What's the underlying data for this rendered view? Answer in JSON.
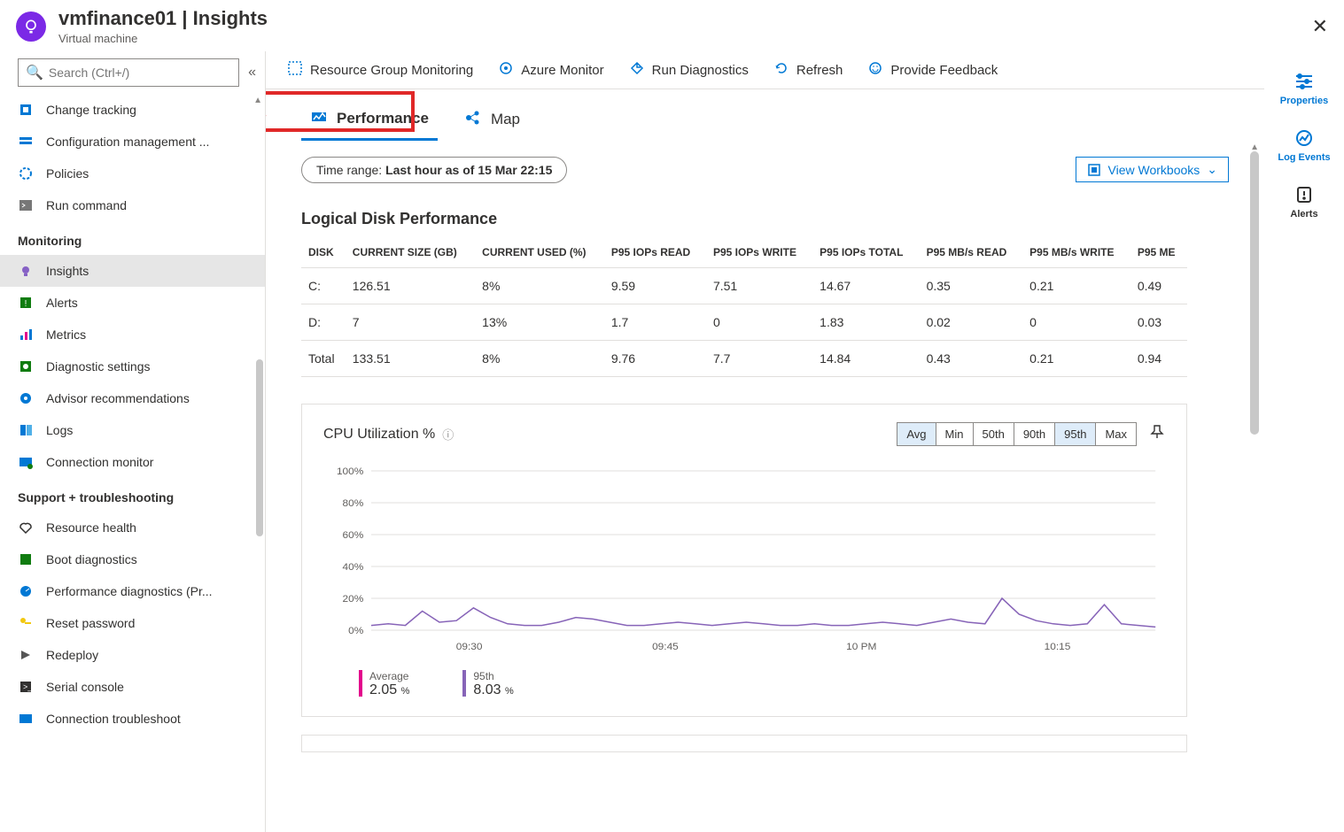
{
  "header": {
    "title": "vmfinance01 | Insights",
    "subtitle": "Virtual machine"
  },
  "search": {
    "placeholder": "Search (Ctrl+/)"
  },
  "nav": {
    "items_top": [
      {
        "label": "Change tracking",
        "icon": "change"
      },
      {
        "label": "Configuration management ...",
        "icon": "config"
      },
      {
        "label": "Policies",
        "icon": "policy"
      },
      {
        "label": "Run command",
        "icon": "runcmd"
      }
    ],
    "section1": "Monitoring",
    "items_mon": [
      {
        "label": "Insights",
        "icon": "insights",
        "selected": true
      },
      {
        "label": "Alerts",
        "icon": "alerts"
      },
      {
        "label": "Metrics",
        "icon": "metrics"
      },
      {
        "label": "Diagnostic settings",
        "icon": "diag"
      },
      {
        "label": "Advisor recommendations",
        "icon": "advisor"
      },
      {
        "label": "Logs",
        "icon": "logs"
      },
      {
        "label": "Connection monitor",
        "icon": "connmon"
      }
    ],
    "section2": "Support + troubleshooting",
    "items_sup": [
      {
        "label": "Resource health",
        "icon": "health"
      },
      {
        "label": "Boot diagnostics",
        "icon": "boot"
      },
      {
        "label": "Performance diagnostics (Pr...",
        "icon": "perf"
      },
      {
        "label": "Reset password",
        "icon": "key"
      },
      {
        "label": "Redeploy",
        "icon": "redeploy"
      },
      {
        "label": "Serial console",
        "icon": "serial"
      },
      {
        "label": "Connection troubleshoot",
        "icon": "conntrouble"
      }
    ]
  },
  "toolbar": {
    "items": [
      {
        "label": "Resource Group Monitoring",
        "icon": "rg"
      },
      {
        "label": "Azure Monitor",
        "icon": "azmon"
      },
      {
        "label": "Run Diagnostics",
        "icon": "rundiag"
      },
      {
        "label": "Refresh",
        "icon": "refresh"
      },
      {
        "label": "Provide Feedback",
        "icon": "feedback"
      }
    ]
  },
  "tabs": {
    "performance": "Performance",
    "map": "Map"
  },
  "timerange": {
    "prefix": "Time range: ",
    "value": "Last hour as of 15 Mar 22:15"
  },
  "view_workbooks": "View Workbooks",
  "disk_section_title": "Logical Disk Performance",
  "disk_table": {
    "headers": [
      "DISK",
      "CURRENT SIZE (GB)",
      "CURRENT USED (%)",
      "P95 IOPs READ",
      "P95 IOPs WRITE",
      "P95 IOPs TOTAL",
      "P95 MB/s READ",
      "P95 MB/s WRITE",
      "P95 ME"
    ],
    "rows": [
      [
        "C:",
        "126.51",
        "8%",
        "9.59",
        "7.51",
        "14.67",
        "0.35",
        "0.21",
        "0.49"
      ],
      [
        "D:",
        "7",
        "13%",
        "1.7",
        "0",
        "1.83",
        "0.02",
        "0",
        "0.03"
      ],
      [
        "Total",
        "133.51",
        "8%",
        "9.76",
        "7.7",
        "14.84",
        "0.43",
        "0.21",
        "0.94"
      ]
    ]
  },
  "chart": {
    "title": "CPU Utilization %",
    "segments": [
      "Avg",
      "Min",
      "50th",
      "90th",
      "95th",
      "Max"
    ],
    "active_segments": [
      "Avg",
      "95th"
    ],
    "legend": [
      {
        "name": "Average",
        "value": "2.05",
        "unit": "%",
        "color": "#e3008c"
      },
      {
        "name": "95th",
        "value": "8.03",
        "unit": "%",
        "color": "#8764b8"
      }
    ]
  },
  "chart_data": {
    "type": "line",
    "title": "CPU Utilization %",
    "xlabel": "",
    "ylabel": "%",
    "ylim": [
      0,
      100
    ],
    "x_ticks": [
      "09:30",
      "09:45",
      "10 PM",
      "10:15"
    ],
    "y_ticks": [
      0,
      20,
      40,
      60,
      80,
      100
    ],
    "series": [
      {
        "name": "95th",
        "color": "#8764b8",
        "values": [
          3,
          4,
          3,
          12,
          5,
          6,
          14,
          8,
          4,
          3,
          3,
          5,
          8,
          7,
          5,
          3,
          3,
          4,
          5,
          4,
          3,
          4,
          5,
          4,
          3,
          3,
          4,
          3,
          3,
          4,
          5,
          4,
          3,
          5,
          7,
          5,
          4,
          20,
          10,
          6,
          4,
          3,
          4,
          16,
          4,
          3,
          2
        ]
      }
    ]
  },
  "rail": {
    "properties": "Properties",
    "logevents": "Log Events",
    "alerts": "Alerts"
  }
}
